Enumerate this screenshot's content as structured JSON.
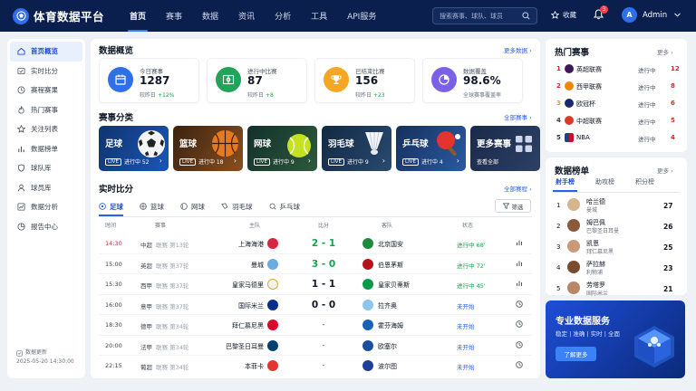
{
  "app": {
    "title": "体育数据平台"
  },
  "nav": [
    "首页",
    "赛事",
    "数据",
    "资讯",
    "分析",
    "工具",
    "API服务"
  ],
  "search": {
    "placeholder": "搜索赛事、球队、球员"
  },
  "topbar": {
    "favorite": "收藏",
    "notif_count": "3",
    "user": "Admin",
    "avatar_letter": "A"
  },
  "sidebar": {
    "items": [
      "首页概览",
      "实时比分",
      "赛程赛果",
      "热门赛事",
      "关注列表",
      "数据榜单",
      "球队库",
      "球员库",
      "数据分析",
      "报告中心"
    ],
    "update_label": "数据更新",
    "update_time": "2025-05-20 14:30:00"
  },
  "overview": {
    "title": "数据概览",
    "more": "更多数据",
    "stats": [
      {
        "label": "今日赛事",
        "value": "1287",
        "sub_prefix": "较昨日",
        "sub_delta": "+12%"
      },
      {
        "label": "进行中比赛",
        "value": "87",
        "sub_prefix": "较昨日",
        "sub_delta": "+8"
      },
      {
        "label": "已结束比赛",
        "value": "156",
        "sub_prefix": "较昨日",
        "sub_delta": "+23"
      },
      {
        "label": "数据覆盖",
        "value": "98.6%",
        "sub_prefix": "全球赛事覆盖率",
        "sub_delta": ""
      }
    ]
  },
  "categories": {
    "title": "赛事分类",
    "more": "全部赛事",
    "cards": [
      {
        "name": "足球",
        "live": "LIVE",
        "text": "进行中 52"
      },
      {
        "name": "篮球",
        "live": "LIVE",
        "text": "进行中 18"
      },
      {
        "name": "网球",
        "live": "LIVE",
        "text": "进行中 9"
      },
      {
        "name": "羽毛球",
        "live": "LIVE",
        "text": "进行中 9"
      },
      {
        "name": "乒乓球",
        "live": "LIVE",
        "text": "进行中 4"
      },
      {
        "name": "更多赛事",
        "live": "",
        "text": "查看全部"
      }
    ]
  },
  "live": {
    "title": "实时比分",
    "more": "全部赛程",
    "filter": "筛选",
    "tabs": [
      "足球",
      "篮球",
      "网球",
      "羽毛球",
      "乒乓球"
    ],
    "headers": [
      "时间",
      "赛事",
      "主队",
      "比分",
      "客队",
      "状态"
    ],
    "rows": [
      {
        "time": "14:30",
        "league": "中超",
        "round": "联赛 第13轮",
        "home": "上海海港",
        "score": "2 - 1",
        "away": "北京国安",
        "status": "进行中 68'"
      },
      {
        "time": "15:00",
        "league": "英超",
        "round": "联赛 第37轮",
        "home": "曼城",
        "score": "3 - 0",
        "away": "伯恩茅斯",
        "status": "进行中 72'"
      },
      {
        "time": "15:30",
        "league": "西甲",
        "round": "联赛 第37轮",
        "home": "皇家马德里",
        "score": "1 - 1",
        "away": "皇家贝蒂斯",
        "status": "进行中 45'"
      },
      {
        "time": "16:00",
        "league": "意甲",
        "round": "联赛 第37轮",
        "home": "国际米兰",
        "score": "0 - 0",
        "away": "拉齐奥",
        "status": "未开始"
      },
      {
        "time": "18:30",
        "league": "德甲",
        "round": "联赛 第34轮",
        "home": "拜仁慕尼黑",
        "score": "-",
        "away": "霍芬海姆",
        "status": "未开始"
      },
      {
        "time": "20:00",
        "league": "法甲",
        "round": "联赛 第34轮",
        "home": "巴黎圣日耳曼",
        "score": "-",
        "away": "欧塞尔",
        "status": "未开始"
      },
      {
        "time": "22:15",
        "league": "葡超",
        "round": "联赛 第34轮",
        "home": "本菲卡",
        "score": "-",
        "away": "波尔图",
        "status": "未开始"
      }
    ]
  },
  "hot": {
    "title": "热门赛事",
    "more": "更多",
    "items": [
      {
        "rank": "1",
        "name": "英超联赛",
        "status": "进行中",
        "count": "12"
      },
      {
        "rank": "2",
        "name": "西甲联赛",
        "status": "进行中",
        "count": "8"
      },
      {
        "rank": "3",
        "name": "欧冠杯",
        "status": "进行中",
        "count": "6"
      },
      {
        "rank": "4",
        "name": "中超联赛",
        "status": "进行中",
        "count": "5"
      },
      {
        "rank": "5",
        "name": "NBA",
        "status": "进行中",
        "count": "4"
      }
    ]
  },
  "board": {
    "title": "数据榜单",
    "more": "更多",
    "tabs": [
      "射手榜",
      "助攻榜",
      "积分榜"
    ],
    "items": [
      {
        "rank": "1",
        "name": "哈兰德",
        "team": "曼城",
        "goals": "27"
      },
      {
        "rank": "2",
        "name": "姆巴佩",
        "team": "巴黎圣日耳曼",
        "goals": "26"
      },
      {
        "rank": "3",
        "name": "凯恩",
        "team": "拜仁慕尼黑",
        "goals": "25"
      },
      {
        "rank": "4",
        "name": "萨拉赫",
        "team": "利物浦",
        "goals": "23"
      },
      {
        "rank": "5",
        "name": "劳塔罗",
        "team": "国际米兰",
        "goals": "21"
      }
    ]
  },
  "promo": {
    "title": "专业数据服务",
    "subtitle": "稳定 | 准确 | 实时 | 全面",
    "button": "了解更多"
  },
  "colors": {
    "accent": "#2563eb",
    "live": "#16a34a",
    "alert": "#dc2626",
    "nav_bg": "#0a1f4d"
  }
}
